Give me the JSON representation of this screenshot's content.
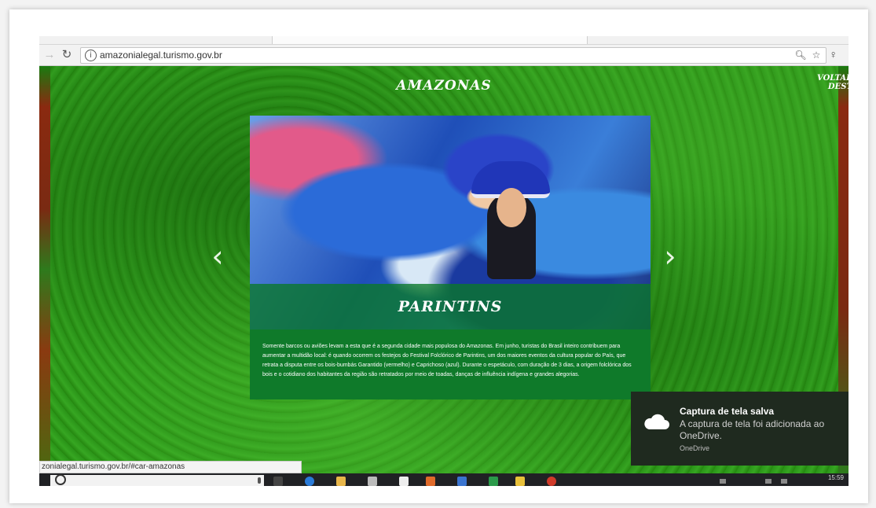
{
  "browser": {
    "url": "amazonialegal.turismo.gov.br",
    "status_url": "zonialegal.turismo.gov.br/#car-amazonas",
    "icons": {
      "back": "arrow-left-icon",
      "reload": "reload-icon",
      "info": "info-icon",
      "zoom": "zoom-icon",
      "bookmark": "star-icon",
      "extension": "extension-icon"
    }
  },
  "page": {
    "title": "AMAZONAS",
    "back_link": "VOLTAR PA\n    DESTI",
    "card": {
      "label": "PARINTINS",
      "description": "Somente barcos ou aviões levam a esta que é a segunda cidade mais populosa do Amazonas. Em junho, turistas do Brasil inteiro contribuem para aumentar a multidão local: é quando ocorrem os festejos do Festival Folclórico de Parintins, um dos maiores eventos da cultura popular do País, que retrata a disputa entre os bois-bumbás Garantido (vermelho) e Caprichoso (azul). Durante o espetáculo, com duração de 3 dias, a origem folclórica dos bois e o cotidiano dos habitantes da região são retratados por meio de toadas, danças de influência indígena e grandes alegorias."
    },
    "arrows": {
      "prev": "‹",
      "next": "›"
    }
  },
  "toast": {
    "title": "Captura de tela salva",
    "body": "A captura de tela foi adicionada ao OneDrive.",
    "app": "OneDrive",
    "icon": "cloud-icon"
  },
  "taskbar": {
    "clock": "15:59"
  }
}
